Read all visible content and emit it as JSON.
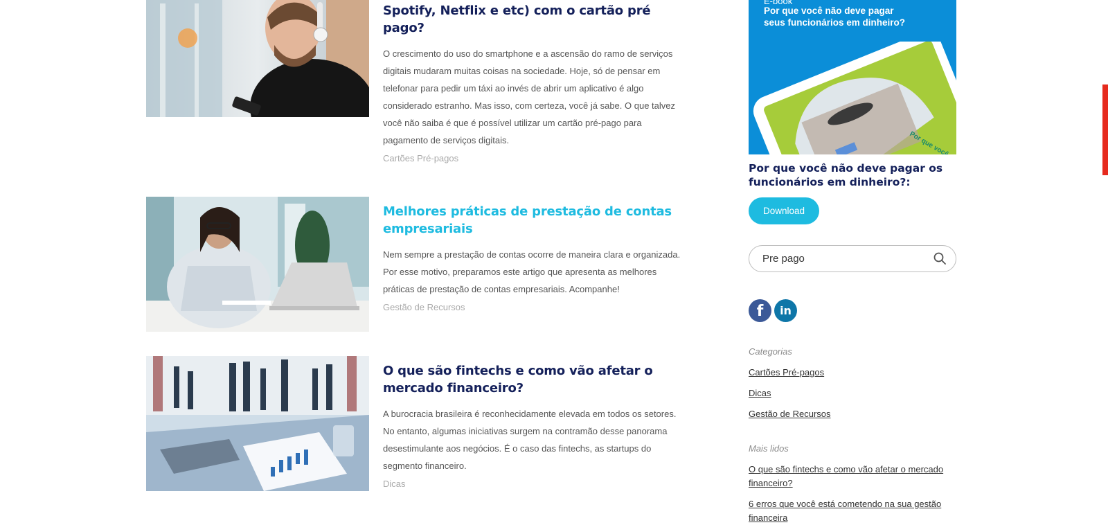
{
  "posts": [
    {
      "title": "Como utilizar os serviços digitais (Uber, Spotify, Netflix e etc) com o cartão pré pago?",
      "excerpt": "O crescimento do uso do smartphone e a ascensão do ramo de serviços digitais mudaram muitas coisas na sociedade. Hoje, só de pensar em telefonar para pedir um táxi ao invés de abrir um aplicativo é algo considerado estranho. Mas isso, com certeza, você já sabe. O que talvez você não saiba é que é possível utilizar um cartão pré-pago para pagamento de serviços digitais.",
      "category": "Cartões Pré-pagos"
    },
    {
      "title": "Melhores práticas de prestação de contas empresariais",
      "excerpt": "Nem sempre a prestação de contas ocorre de maneira clara e organizada. Por esse motivo, preparamos este artigo que apresenta as melhores práticas de prestação de contas empresariais. Acompanhe!",
      "category": "Gestão de Recursos"
    },
    {
      "title": "O que são fintechs e como vão afetar o mercado financeiro?",
      "excerpt": "A burocracia brasileira é reconhecidamente elevada em todos os setores. No entanto, algumas iniciativas surgem na contramão desse panorama desestimulante aos negócios. É o caso das fintechs, as startups do segmento financeiro.",
      "category": "Dicas"
    }
  ],
  "sidebar": {
    "ebook": {
      "label": "E-book",
      "title": "Por que você não deve pagar seus funcionários em dinheiro?",
      "cover_text": "Por que você deve pagar seus funcion..."
    },
    "heading": "Por que você não deve pagar os funcionários em dinheiro?:",
    "download_label": "Download",
    "search": {
      "value": "Pre pago"
    },
    "social": {
      "facebook": "f",
      "linkedin": "in"
    },
    "categories_label": "Categorias",
    "categories": [
      "Cartões Pré-pagos",
      "Dicas",
      "Gestão de Recursos"
    ],
    "most_read_label": "Mais lidos",
    "most_read": [
      "O que são fintechs e como vão afetar o mercado financeiro?",
      "6 erros que você está cometendo na sua gestão financeira"
    ]
  },
  "colors": {
    "title_navy": "#14205a",
    "accent_cyan": "#1ebbe0",
    "ebook_blue": "#0b8ed8",
    "ebook_green": "#a6cc3a",
    "facebook_blue": "#3b5998",
    "linkedin_blue": "#0e76a8",
    "scrollbar_red": "#e62b1e"
  }
}
